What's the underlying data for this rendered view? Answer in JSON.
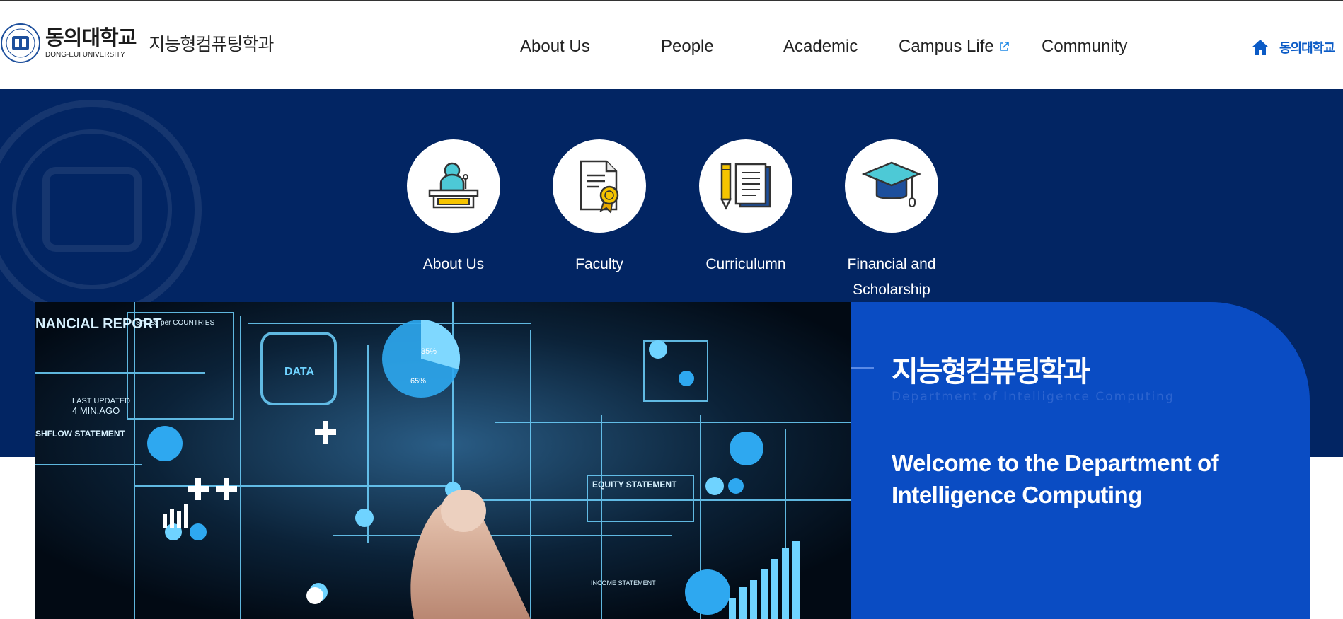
{
  "header": {
    "university_name_ko": "동의대학교",
    "university_name_en": "DONG-EUI UNIVERSITY",
    "department_name": "지능형컴퓨팅학과",
    "nav": [
      {
        "label": "About Us"
      },
      {
        "label": "People"
      },
      {
        "label": "Academic"
      },
      {
        "label": "Campus Life"
      },
      {
        "label": "Community"
      }
    ],
    "home_link_label": "동의대학교"
  },
  "quick_links": [
    {
      "label": "About Us",
      "icon": "lecture-podium-icon"
    },
    {
      "label": "Faculty",
      "icon": "certificate-icon"
    },
    {
      "label": "Curriculumn",
      "icon": "notebook-pencil-icon"
    },
    {
      "label": "Financial and Scholarship",
      "icon": "graduation-cap-icon"
    }
  ],
  "hero_panel": {
    "title_ko": "지능형컴퓨팅학과",
    "title_en": "Department of Intelligence Computing",
    "welcome": "Welcome to the Department of Intelligence Computing"
  },
  "hero_image": {
    "report_title": "NANCIAL REPORT",
    "sales_label": "SALES per COUNTRIES",
    "data_label": "DATA",
    "pie_a": "35%",
    "pie_b": "65%",
    "last_updated": "LAST UPDATED",
    "ago": "4 MIN.AGO",
    "cashflow": "SHFLOW STATEMENT",
    "equity": "EQUITY STATEMENT",
    "income": "INCOME STATEMENT"
  },
  "colors": {
    "navy_band": "#022563",
    "panel_blue": "#0a4cc3",
    "link_blue": "#0b5bc6"
  }
}
